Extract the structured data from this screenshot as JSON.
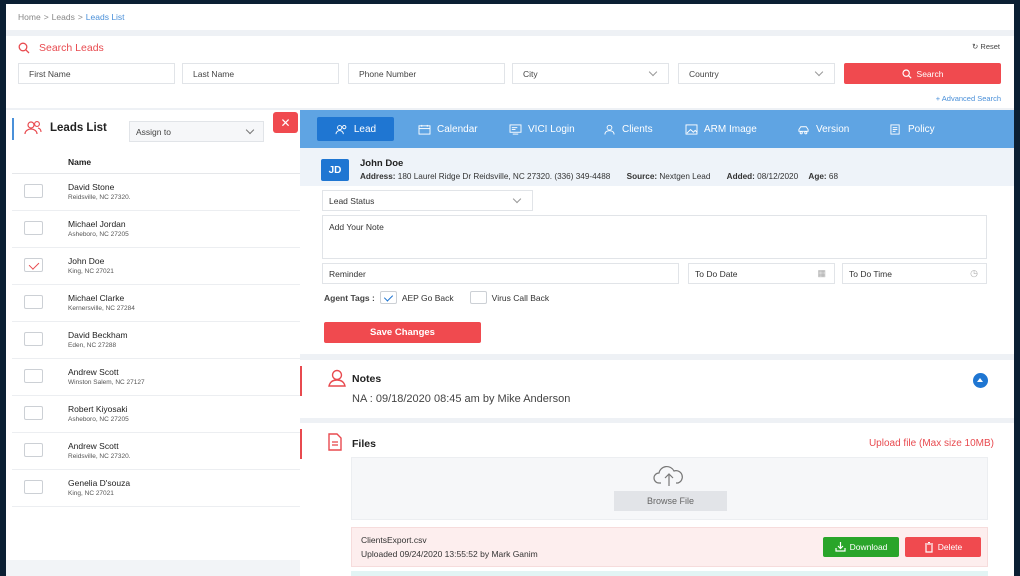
{
  "breadcrumb": {
    "home": "Home",
    "leads": "Leads",
    "current": "Leads List",
    "sep": ">"
  },
  "search": {
    "title": "Search Leads",
    "reset": "Reset",
    "first_name": "First Name",
    "last_name": "Last Name",
    "phone": "Phone Number",
    "city": "City",
    "country": "Country",
    "button": "Search",
    "advanced": "+ Advanced Search"
  },
  "leads_list": {
    "title": "Leads List",
    "assign_to": "Assign to",
    "column_name": "Name",
    "items": [
      {
        "name": "David Stone",
        "address": "Reidsville, NC 27320.",
        "checked": false
      },
      {
        "name": "Michael Jordan",
        "address": "Asheboro, NC 27205",
        "checked": false
      },
      {
        "name": "John Doe",
        "address": "King, NC 27021",
        "checked": true
      },
      {
        "name": "Michael Clarke",
        "address": "Kernersville, NC 27284",
        "checked": false
      },
      {
        "name": "David Beckham",
        "address": "Eden, NC 27288",
        "checked": false
      },
      {
        "name": "Andrew Scott",
        "address": "Winston Salem, NC 27127",
        "checked": false
      },
      {
        "name": "Robert Kiyosaki",
        "address": "Asheboro, NC 27205",
        "checked": false
      },
      {
        "name": "Andrew Scott",
        "address": "Reidsville, NC 27320.",
        "checked": false
      },
      {
        "name": "Genelia D'souza",
        "address": "King, NC 27021",
        "checked": false
      }
    ]
  },
  "tabs": [
    "Lead",
    "Calendar",
    "VICI Login",
    "Clients",
    "ARM Image",
    "Version",
    "Policy"
  ],
  "lead": {
    "initials": "JD",
    "name": "John Doe",
    "address_label": "Address:",
    "address": "180 Laurel Ridge Dr Reidsville, NC 27320.",
    "phone": "(336) 349-4488",
    "source_label": "Source:",
    "source": "Nextgen Lead",
    "added_label": "Added:",
    "added": "08/12/2020",
    "age_label": "Age:",
    "age": "68",
    "status_placeholder": "Lead Status",
    "note_placeholder": "Add Your Note",
    "reminder": "Reminder",
    "todo_date": "To Do Date",
    "todo_time": "To Do Time",
    "agent_tags_label": "Agent Tags :",
    "tag_aep": "AEP Go Back",
    "tag_virus": "Virus Call Back",
    "save": "Save Changes"
  },
  "notes": {
    "title": "Notes",
    "entry": "NA : 09/18/2020 08:45 am by Mike Anderson"
  },
  "files": {
    "title": "Files",
    "upload_label": "Upload file (Max size 10MB)",
    "browse": "Browse File",
    "file_name": "ClientsExport.csv",
    "uploaded": "Uploaded 09/24/2020 13:55:52 by Mark Ganim",
    "download": "Download",
    "delete": "Delete"
  },
  "colors": {
    "accent_red": "#f04a4f",
    "accent_blue": "#1f76d2",
    "tab_bar": "#5fa4e3",
    "download_green": "#2aa52a"
  }
}
